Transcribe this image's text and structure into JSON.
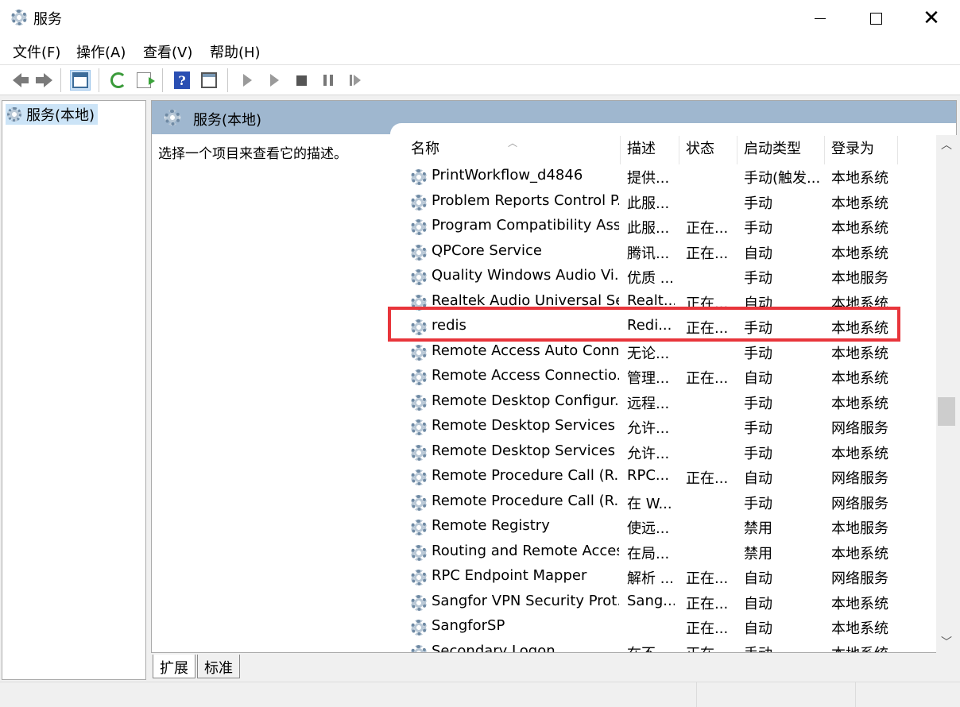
{
  "window": {
    "title": "服务"
  },
  "menu": [
    "文件(F)",
    "操作(A)",
    "查看(V)",
    "帮助(H)"
  ],
  "tree": {
    "root_label": "服务(本地)"
  },
  "panel": {
    "title": "服务(本地)",
    "description_prompt": "选择一个项目来查看它的描述。"
  },
  "columns": [
    "名称",
    "描述",
    "状态",
    "启动类型",
    "登录为"
  ],
  "rows": [
    {
      "name": "PrintWorkflow_d4846",
      "desc": "提供...",
      "status": "",
      "startup": "手动(触发...",
      "logon": "本地系统"
    },
    {
      "name": "Problem Reports Control P...",
      "desc": "此服...",
      "status": "",
      "startup": "手动",
      "logon": "本地系统"
    },
    {
      "name": "Program Compatibility Assi...",
      "desc": "此服...",
      "status": "正在...",
      "startup": "手动",
      "logon": "本地系统"
    },
    {
      "name": "QPCore Service",
      "desc": "腾讯...",
      "status": "正在...",
      "startup": "自动",
      "logon": "本地系统"
    },
    {
      "name": "Quality Windows Audio Vi...",
      "desc": "优质 ...",
      "status": "",
      "startup": "手动",
      "logon": "本地服务"
    },
    {
      "name": "Realtek Audio Universal Se...",
      "desc": "Realt...",
      "status": "正在...",
      "startup": "自动",
      "logon": "本地系统"
    },
    {
      "name": "redis",
      "desc": "Redi...",
      "status": "正在...",
      "startup": "手动",
      "logon": "本地系统"
    },
    {
      "name": "Remote Access Auto Conn...",
      "desc": "无论...",
      "status": "",
      "startup": "手动",
      "logon": "本地系统"
    },
    {
      "name": "Remote Access Connectio...",
      "desc": "管理...",
      "status": "正在...",
      "startup": "自动",
      "logon": "本地系统"
    },
    {
      "name": "Remote Desktop Configur...",
      "desc": "远程...",
      "status": "",
      "startup": "手动",
      "logon": "本地系统"
    },
    {
      "name": "Remote Desktop Services",
      "desc": "允许...",
      "status": "",
      "startup": "手动",
      "logon": "网络服务"
    },
    {
      "name": "Remote Desktop Services ...",
      "desc": "允许...",
      "status": "",
      "startup": "手动",
      "logon": "本地系统"
    },
    {
      "name": "Remote Procedure Call (R...",
      "desc": "RPC...",
      "status": "正在...",
      "startup": "自动",
      "logon": "网络服务"
    },
    {
      "name": "Remote Procedure Call (R...",
      "desc": "在 W...",
      "status": "",
      "startup": "手动",
      "logon": "网络服务"
    },
    {
      "name": "Remote Registry",
      "desc": "使远...",
      "status": "",
      "startup": "禁用",
      "logon": "本地服务"
    },
    {
      "name": "Routing and Remote Access",
      "desc": "在局...",
      "status": "",
      "startup": "禁用",
      "logon": "本地系统"
    },
    {
      "name": "RPC Endpoint Mapper",
      "desc": "解析 ...",
      "status": "正在...",
      "startup": "自动",
      "logon": "网络服务"
    },
    {
      "name": "Sangfor VPN Security Prot...",
      "desc": "Sang...",
      "status": "正在...",
      "startup": "自动",
      "logon": "本地系统"
    },
    {
      "name": "SangforSP",
      "desc": "",
      "status": "正在...",
      "startup": "自动",
      "logon": "本地系统"
    },
    {
      "name": "Secondary Logon",
      "desc": "在不...",
      "status": "正在...",
      "startup": "手动",
      "logon": "本地系统"
    }
  ],
  "highlighted_service": "redis",
  "tabs": [
    "扩展",
    "标准"
  ],
  "colors": {
    "highlight_box": "#e8353b",
    "panel_header": "#9fb7cf",
    "selection": "#cce4f7"
  },
  "icons": [
    "gear-icon",
    "back-arrow-icon",
    "forward-arrow-icon",
    "console-tree-icon",
    "refresh-icon",
    "export-list-icon",
    "help-icon",
    "properties-icon",
    "start-icon",
    "start-params-icon",
    "stop-icon",
    "pause-icon",
    "resume-icon"
  ]
}
